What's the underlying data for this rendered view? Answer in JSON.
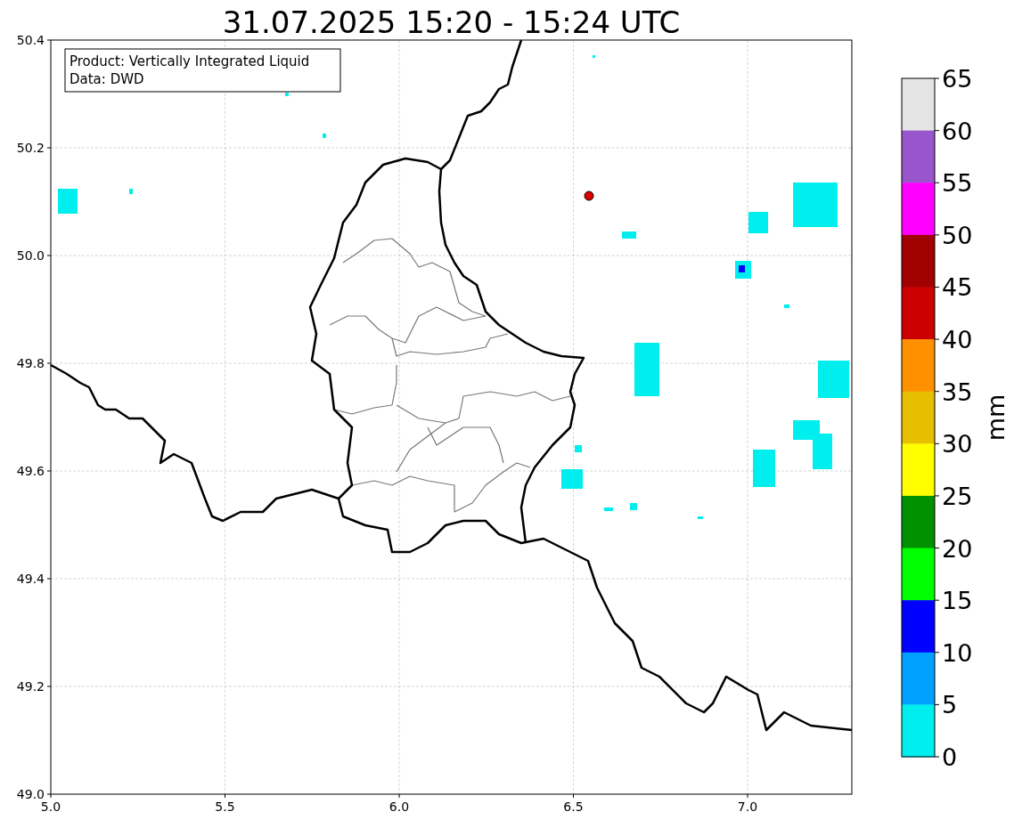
{
  "title": "31.07.2025 15:20 - 15:24 UTC",
  "info_box": {
    "lines": [
      "Product: Vertically Integrated Liquid",
      "Data: DWD"
    ]
  },
  "xticks": [
    "5.0",
    "5.5",
    "6.0",
    "6.5",
    "7.0"
  ],
  "yticks": [
    "50.4",
    "50.2",
    "50.0",
    "49.8",
    "49.6",
    "49.4",
    "49.2",
    "49.0"
  ],
  "colorbar": {
    "label": "mm",
    "ticks": [
      "65",
      "60",
      "55",
      "50",
      "45",
      "40",
      "35",
      "30",
      "25",
      "20",
      "15",
      "10",
      "5",
      "0"
    ],
    "segments": [
      {
        "color": "#e4e4e4"
      },
      {
        "color": "#9955cc"
      },
      {
        "color": "#ff00ff"
      },
      {
        "color": "#a00000"
      },
      {
        "color": "#cc0000"
      },
      {
        "color": "#ff9000"
      },
      {
        "color": "#e6c000"
      },
      {
        "color": "#ffff00"
      },
      {
        "color": "#009000"
      },
      {
        "color": "#00ff00"
      },
      {
        "color": "#0000ff"
      },
      {
        "color": "#00a0ff"
      },
      {
        "color": "#00eeee"
      }
    ]
  }
}
